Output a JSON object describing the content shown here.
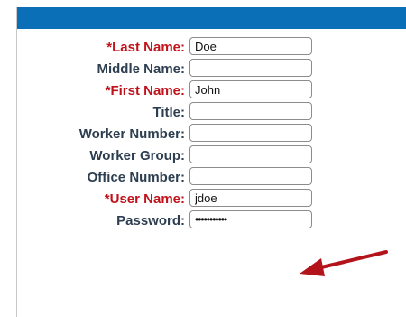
{
  "form": {
    "fields": [
      {
        "label": "*Last Name:",
        "value": "Doe",
        "required": true
      },
      {
        "label": "Middle Name:",
        "value": "",
        "required": false
      },
      {
        "label": "*First Name:",
        "value": "John",
        "required": true
      },
      {
        "label": "Title:",
        "value": "",
        "required": false
      },
      {
        "label": "Worker Number:",
        "value": "",
        "required": false
      },
      {
        "label": "Worker Group:",
        "value": "",
        "required": false
      },
      {
        "label": "Office Number:",
        "value": "",
        "required": false
      },
      {
        "label": "*User Name:",
        "value": "jdoe",
        "required": true
      },
      {
        "label": "Password:",
        "value": "•••••••••••",
        "required": false
      }
    ]
  },
  "colors": {
    "header": "#0a6fb6",
    "required_label": "#c0121b",
    "label": "#2c3e50",
    "annotation_arrow": "#b3141b"
  },
  "annotation": {
    "icon": "red-arrow-icon",
    "points_to": "password-field"
  }
}
